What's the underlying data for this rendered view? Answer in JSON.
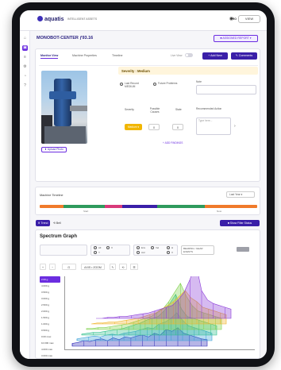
{
  "header": {
    "logo": "aquatis",
    "tagline": "INTELLIGENT ASSETS",
    "pro_label": "PRO",
    "user_menu": "VIEW"
  },
  "asset": {
    "title": "MONOBOT-CENTER ƒ93.16",
    "dropdown": "■ ASSIGNED REPORT ▾"
  },
  "tabs": [
    {
      "label": "Monitor View"
    },
    {
      "label": "Machine Properties"
    },
    {
      "label": "Timeline"
    }
  ],
  "toolbar": {
    "toggle_label": "Live View",
    "add_label": "+ Add New",
    "comments_label": "✎ Comments"
  },
  "photo": {
    "upload_label": "⬆ Upload Photo"
  },
  "severity": {
    "title": "Severity : Medium",
    "option_last_modified": "Last Record MEDIUM",
    "option_future": "Future Problems",
    "notes_label": "Note",
    "notes_placeholder": "",
    "severity_label": "Severity",
    "possible_label": "Possible Causes",
    "state_label": "State",
    "recommend_label": "Recommended Action",
    "chip": "Medium ▾",
    "step_value_1": "0",
    "step_value_2": "0",
    "recommend_placeholder": "Type here...",
    "add_link": "+ ADD FINDINGS"
  },
  "timeline": {
    "title": "Machine Timeline",
    "range": "Last Year ▾",
    "tick_start": "Start",
    "tick_end": "Now",
    "segments": [
      {
        "color": "#f07a2a",
        "fraction": 0.11
      },
      {
        "color": "#2e9a5c",
        "fraction": 0.19
      },
      {
        "color": "#d83a7a",
        "fraction": 0.08
      },
      {
        "color": "#3a1fa8",
        "fraction": 0.16
      },
      {
        "color": "#2e9a5c",
        "fraction": 0.22
      },
      {
        "color": "#f07a2a",
        "fraction": 0.24
      }
    ]
  },
  "actions": {
    "primary": "⬆ Trend",
    "link": "⟲ Bell",
    "right": "■ Show Filter Status"
  },
  "spectrum": {
    "title": "Spectrum Graph",
    "options_a": [
      "All",
      "X",
      "Y"
    ],
    "options_b": [
      "Env",
      "Vel",
      "Acc"
    ],
    "options_c": [
      "H",
      "V"
    ],
    "select_label": "BEARING / GEAR EVENTS",
    "tools": [
      "+",
      "−",
      "⊡",
      "AXIS • ZOOM",
      "✎",
      "⟲",
      "☰"
    ],
    "frequencies": [
      "2.00 g",
      "4.000 g",
      "3.500 g",
      "3.000 g",
      "2.500 g",
      "2.000 g",
      "1.500 g",
      "1.000 g",
      "0.500 g",
      "0.00 max",
      "10.000 max",
      "4.000 max",
      "3.000 max"
    ]
  },
  "chart_data": {
    "type": "area",
    "title": "",
    "xlabel": "",
    "ylabel": "",
    "series": [
      {
        "color": "#2f2ab8",
        "values": [
          3,
          4,
          6,
          5,
          7,
          8,
          6,
          9,
          7,
          10,
          9,
          11,
          12,
          10,
          14,
          12,
          18,
          16,
          20,
          14,
          12,
          10,
          8,
          7
        ]
      },
      {
        "color": "#3aa0d8",
        "values": [
          2,
          3,
          4,
          5,
          4,
          6,
          7,
          6,
          8,
          9,
          10,
          12,
          14,
          13,
          18,
          20,
          24,
          30,
          22,
          16,
          14,
          12,
          10,
          8
        ]
      },
      {
        "color": "#2ebf8c",
        "values": [
          1,
          2,
          3,
          3,
          4,
          5,
          6,
          7,
          9,
          11,
          13,
          16,
          18,
          20,
          26,
          34,
          44,
          28,
          20,
          18,
          16,
          14,
          12,
          10
        ]
      },
      {
        "color": "#7ed04a",
        "values": [
          1,
          1,
          2,
          2,
          3,
          4,
          5,
          6,
          8,
          10,
          12,
          14,
          18,
          22,
          30,
          40,
          50,
          36,
          26,
          20,
          18,
          16,
          14,
          12
        ]
      },
      {
        "color": "#f0b42a",
        "values": [
          0,
          1,
          1,
          2,
          2,
          3,
          4,
          5,
          6,
          8,
          10,
          12,
          16,
          20,
          24,
          30,
          36,
          28,
          24,
          18,
          16,
          14,
          12,
          10
        ]
      },
      {
        "color": "#8a3ad8",
        "values": [
          0,
          0,
          1,
          1,
          2,
          2,
          3,
          4,
          5,
          6,
          8,
          10,
          12,
          14,
          20,
          28,
          42,
          60,
          30,
          20,
          16,
          14,
          12,
          10
        ]
      }
    ]
  }
}
